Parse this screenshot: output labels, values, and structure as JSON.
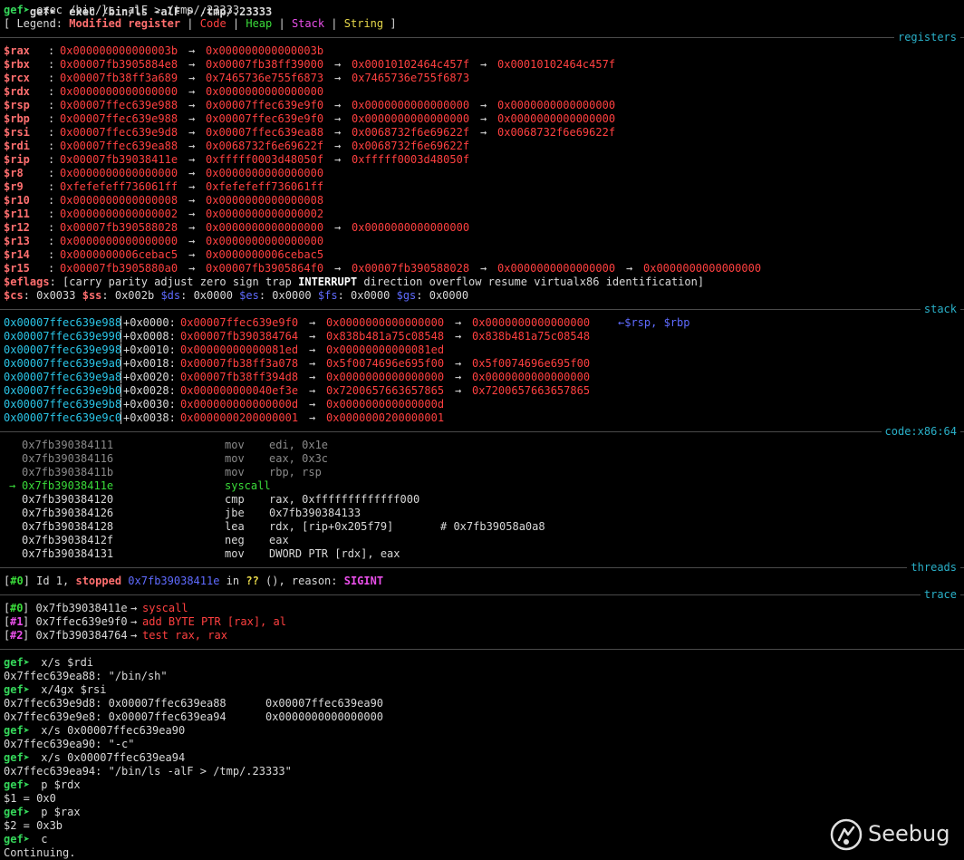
{
  "header": {
    "prev_line": "gef➤  exec /bin/ls -alF > /tmp/.23333",
    "prompt": "gef➤",
    "cmd": " exec /bin/ls -alF > /tmp/.23333",
    "legend": {
      "open": "[ Legend: ",
      "modified": "Modified register",
      "sep": " | ",
      "code": "Code",
      "heap": "Heap",
      "stack": "Stack",
      "string": "String",
      "close": " ]"
    }
  },
  "sections": {
    "registers": "registers",
    "stack": "stack",
    "code": "code:x86:64",
    "threads": "threads",
    "trace": "trace"
  },
  "registers": [
    {
      "name": "$rax",
      "chain": [
        "0x000000000000003b",
        "0x000000000000003b"
      ]
    },
    {
      "name": "$rbx",
      "chain": [
        "0x00007fb3905884e8",
        "0x00007fb38ff39000",
        "0x00010102464c457f",
        "0x00010102464c457f"
      ]
    },
    {
      "name": "$rcx",
      "chain": [
        "0x00007fb38ff3a689",
        "0x7465736e755f6873",
        "0x7465736e755f6873"
      ]
    },
    {
      "name": "$rdx",
      "chain": [
        "0x0000000000000000",
        "0x0000000000000000"
      ]
    },
    {
      "name": "$rsp",
      "chain": [
        "0x00007ffec639e988",
        "0x00007ffec639e9f0",
        "0x0000000000000000",
        "0x0000000000000000"
      ]
    },
    {
      "name": "$rbp",
      "chain": [
        "0x00007ffec639e988",
        "0x00007ffec639e9f0",
        "0x0000000000000000",
        "0x0000000000000000"
      ]
    },
    {
      "name": "$rsi",
      "chain": [
        "0x00007ffec639e9d8",
        "0x00007ffec639ea88",
        "0x0068732f6e69622f",
        "0x0068732f6e69622f"
      ]
    },
    {
      "name": "$rdi",
      "chain": [
        "0x00007ffec639ea88",
        "0x0068732f6e69622f",
        "0x0068732f6e69622f"
      ]
    },
    {
      "name": "$rip",
      "chain": [
        "0x00007fb39038411e",
        "0xfffff0003d48050f",
        "0xfffff0003d48050f"
      ]
    },
    {
      "name": "$r8",
      "chain": [
        "0x0000000000000000",
        "0x0000000000000000"
      ]
    },
    {
      "name": "$r9",
      "chain": [
        "0xfefefeff736061ff",
        "0xfefefeff736061ff"
      ]
    },
    {
      "name": "$r10",
      "chain": [
        "0x0000000000000008",
        "0x0000000000000008"
      ]
    },
    {
      "name": "$r11",
      "chain": [
        "0x0000000000000002",
        "0x0000000000000002"
      ]
    },
    {
      "name": "$r12",
      "chain": [
        "0x00007fb390588028",
        "0x0000000000000000",
        "0x0000000000000000"
      ]
    },
    {
      "name": "$r13",
      "chain": [
        "0x0000000000000000",
        "0x0000000000000000"
      ]
    },
    {
      "name": "$r14",
      "chain": [
        "0x0000000006cebac5",
        "0x0000000006cebac5"
      ]
    },
    {
      "name": "$r15",
      "chain": [
        "0x00007fb3905880a0",
        "0x00007fb3905864f0",
        "0x00007fb390588028",
        "0x0000000000000000",
        "0x0000000000000000"
      ]
    }
  ],
  "eflags": {
    "name": "$eflags",
    "pre": ": [carry parity adjust zero sign trap ",
    "bold": "INTERRUPT",
    "post": " direction overflow resume virtualx86 identification]"
  },
  "segments": [
    {
      "name": "$cs",
      "value": "0x0033"
    },
    {
      "name": "$ss",
      "value": "0x002b"
    },
    {
      "name": "$ds",
      "value": "0x0000"
    },
    {
      "name": "$es",
      "value": "0x0000"
    },
    {
      "name": "$fs",
      "value": "0x0000"
    },
    {
      "name": "$gs",
      "value": "0x0000"
    }
  ],
  "stack": [
    {
      "addr": "0x00007ffec639e988",
      "off": "+0x0000:",
      "chain": [
        "0x00007ffec639e9f0",
        "0x0000000000000000",
        "0x0000000000000000"
      ],
      "note": "←$rsp, $rbp"
    },
    {
      "addr": "0x00007ffec639e990",
      "off": "+0x0008:",
      "chain": [
        "0x00007fb390384764",
        "0x838b481a75c08548",
        "0x838b481a75c08548"
      ],
      "note": ""
    },
    {
      "addr": "0x00007ffec639e998",
      "off": "+0x0010:",
      "chain": [
        "0x00000000000081ed",
        "0x00000000000081ed"
      ],
      "note": ""
    },
    {
      "addr": "0x00007ffec639e9a0",
      "off": "+0x0018:",
      "chain": [
        "0x00007fb38ff3a078",
        "0x5f0074696e695f00",
        "0x5f0074696e695f00"
      ],
      "note": ""
    },
    {
      "addr": "0x00007ffec639e9a8",
      "off": "+0x0020:",
      "chain": [
        "0x00007fb38ff394d8",
        "0x0000000000000000",
        "0x0000000000000000"
      ],
      "note": ""
    },
    {
      "addr": "0x00007ffec639e9b0",
      "off": "+0x0028:",
      "chain": [
        "0x000000000040ef3e",
        "0x7200657663657865",
        "0x7200657663657865"
      ],
      "note": ""
    },
    {
      "addr": "0x00007ffec639e9b8",
      "off": "+0x0030:",
      "chain": [
        "0x000000000000000d",
        "0x000000000000000d"
      ],
      "note": ""
    },
    {
      "addr": "0x00007ffec639e9c0",
      "off": "+0x0038:",
      "chain": [
        "0x0000000200000001",
        "0x0000000200000001"
      ],
      "note": ""
    }
  ],
  "code": [
    {
      "addr": "0x7fb390384111",
      "mn": "mov",
      "op": "edi, 0x1e",
      "cmt": "",
      "state": "past"
    },
    {
      "addr": "0x7fb390384116",
      "mn": "mov",
      "op": "eax, 0x3c",
      "cmt": "",
      "state": "past"
    },
    {
      "addr": "0x7fb39038411b",
      "mn": "mov",
      "op": "rbp, rsp",
      "cmt": "",
      "state": "past"
    },
    {
      "addr": "0x7fb39038411e",
      "mn": "syscall",
      "op": "",
      "cmt": "",
      "state": "current"
    },
    {
      "addr": "0x7fb390384120",
      "mn": "cmp",
      "op": "rax, 0xfffffffffffff000",
      "cmt": "",
      "state": "next"
    },
    {
      "addr": "0x7fb390384126",
      "mn": "jbe",
      "op": "0x7fb390384133",
      "cmt": "",
      "state": "next"
    },
    {
      "addr": "0x7fb390384128",
      "mn": "lea",
      "op": "rdx, [rip+0x205f79]",
      "cmt": "# 0x7fb39058a0a8",
      "state": "next"
    },
    {
      "addr": "0x7fb39038412f",
      "mn": "neg",
      "op": "eax",
      "cmt": "",
      "state": "next"
    },
    {
      "addr": "0x7fb390384131",
      "mn": "mov",
      "op": "DWORD PTR [rdx], eax",
      "cmt": "",
      "state": "next"
    }
  ],
  "threads": {
    "open": "[",
    "id": "#0",
    "close": "] Id 1, ",
    "stopped": "stopped",
    "addr": "0x7fb39038411e",
    "in": " in ",
    "fn": "??",
    "reason_pre": " (), reason: ",
    "reason": "SIGINT"
  },
  "trace": [
    {
      "id": "#0",
      "addr": "0x7fb39038411e",
      "insn": "syscall"
    },
    {
      "id": "#1",
      "addr": "0x7ffec639e9f0",
      "insn": "add BYTE PTR [rax], al"
    },
    {
      "id": "#2",
      "addr": "0x7fb390384764",
      "insn": "test rax, rax"
    }
  ],
  "console": [
    {
      "type": "cmd",
      "text": " x/s $rdi"
    },
    {
      "type": "out",
      "text": "0x7ffec639ea88: \"/bin/sh\""
    },
    {
      "type": "cmd",
      "text": " x/4gx $rsi"
    },
    {
      "type": "out",
      "text": "0x7ffec639e9d8: 0x00007ffec639ea88      0x00007ffec639ea90"
    },
    {
      "type": "out",
      "text": "0x7ffec639e9e8: 0x00007ffec639ea94      0x0000000000000000"
    },
    {
      "type": "cmd",
      "text": " x/s 0x00007ffec639ea90"
    },
    {
      "type": "out",
      "text": "0x7ffec639ea90: \"-c\""
    },
    {
      "type": "cmd",
      "text": " x/s 0x00007ffec639ea94"
    },
    {
      "type": "out",
      "text": "0x7ffec639ea94: \"/bin/ls -alF > /tmp/.23333\""
    },
    {
      "type": "cmd",
      "text": " p $rdx"
    },
    {
      "type": "out",
      "text": "$1 = 0x0"
    },
    {
      "type": "cmd",
      "text": " p $rax"
    },
    {
      "type": "out",
      "text": "$2 = 0x3b"
    },
    {
      "type": "cmd",
      "text": " c"
    },
    {
      "type": "out",
      "text": "Continuing."
    }
  ],
  "watermark": {
    "text": "Seebug",
    "icon": "seebug-logo-icon"
  },
  "colors": {
    "modified": "#ff6f6f",
    "code": "#ff4040",
    "heap": "#3adb3a",
    "stack": "#e94fe9",
    "string": "#e7d84a",
    "section": "#2ab0c8",
    "prompt": "#35d75a"
  }
}
